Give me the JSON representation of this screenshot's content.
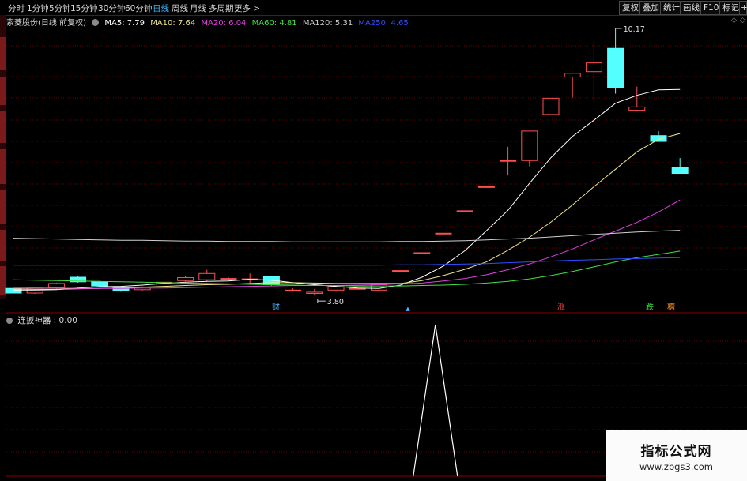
{
  "periods": [
    {
      "label": "分时",
      "active": false
    },
    {
      "label": "1分钟",
      "active": false
    },
    {
      "label": "5分钟",
      "active": false
    },
    {
      "label": "15分钟",
      "active": false
    },
    {
      "label": "30分钟",
      "active": false
    },
    {
      "label": "60分钟",
      "active": false
    },
    {
      "label": "日线",
      "active": true
    },
    {
      "label": "周线",
      "active": false
    },
    {
      "label": "月线",
      "active": false
    },
    {
      "label": "多周期",
      "active": false
    },
    {
      "label": "更多 >",
      "active": false
    }
  ],
  "toolbar_buttons": [
    "复权",
    "叠加",
    "统计",
    "画线",
    "F10",
    "标记",
    "+"
  ],
  "chart_title": "索菱股份(日线 前复权)",
  "ma_legend": [
    {
      "label": "MA5: 7.79",
      "color": "#ffffff"
    },
    {
      "label": "MA10: 7.64",
      "color": "#f0e68c"
    },
    {
      "label": "MA20: 6.04",
      "color": "#e040e0"
    },
    {
      "label": "MA60: 4.81",
      "color": "#40e040"
    },
    {
      "label": "MA120: 5.31",
      "color": "#cfcfcf"
    },
    {
      "label": "MA250: 4.65",
      "color": "#3050ff"
    }
  ],
  "price_high_label": "10.17",
  "price_low_label": "3.80",
  "event_markers": [
    {
      "text": "财",
      "color": "#4db8ff"
    },
    {
      "text": "▲",
      "color": "#4db8ff"
    },
    {
      "text": "涨",
      "color": "#ff4040"
    },
    {
      "text": "跌",
      "color": "#40e040"
    },
    {
      "text": "糟",
      "color": "#ff9020"
    }
  ],
  "indicator_title": "连扳神器 : 0.00",
  "watermark": {
    "title": "指标公式网",
    "url": "www.zbgs3.com"
  },
  "colors": {
    "up": "#ff5050",
    "down": "#54ffff",
    "grid": "#6a0000",
    "indicator_line": "#ffffff"
  },
  "chart_data": {
    "type": "candlestick",
    "candles": [
      {
        "o": 3.91,
        "c": 3.8,
        "h": 3.91,
        "l": 3.8
      },
      {
        "o": 3.8,
        "c": 3.92,
        "h": 3.95,
        "l": 3.78
      },
      {
        "o": 3.93,
        "c": 4.03,
        "h": 4.05,
        "l": 3.9
      },
      {
        "o": 4.18,
        "c": 4.07,
        "h": 4.2,
        "l": 4.05
      },
      {
        "o": 4.07,
        "c": 3.97,
        "h": 4.09,
        "l": 3.95
      },
      {
        "o": 3.93,
        "c": 3.85,
        "h": 3.95,
        "l": 3.83
      },
      {
        "o": 3.88,
        "c": 3.94,
        "h": 3.96,
        "l": 3.86
      },
      {
        "o": 4.05,
        "c": 4.06,
        "h": 4.08,
        "l": 4.03
      },
      {
        "o": 4.1,
        "c": 4.17,
        "h": 4.22,
        "l": 4.08
      },
      {
        "o": 4.12,
        "c": 4.27,
        "h": 4.36,
        "l": 4.08
      },
      {
        "o": 4.14,
        "c": 4.15,
        "h": 4.18,
        "l": 4.1
      },
      {
        "o": 4.13,
        "c": 4.14,
        "h": 4.27,
        "l": 4.04
      },
      {
        "o": 4.2,
        "c": 4.0,
        "h": 4.22,
        "l": 3.98
      },
      {
        "o": 3.86,
        "c": 3.87,
        "h": 3.91,
        "l": 3.84
      },
      {
        "o": 3.79,
        "c": 3.82,
        "h": 3.9,
        "l": 3.74
      },
      {
        "o": 3.87,
        "c": 3.95,
        "h": 3.98,
        "l": 3.86
      },
      {
        "o": 3.9,
        "c": 3.91,
        "h": 3.93,
        "l": 3.89
      },
      {
        "o": 3.87,
        "c": 4.0,
        "h": 4.02,
        "l": 3.85
      },
      {
        "o": 4.34,
        "c": 4.34,
        "h": 4.34,
        "l": 4.34
      },
      {
        "o": 4.77,
        "c": 4.77,
        "h": 4.77,
        "l": 4.77
      },
      {
        "o": 5.24,
        "c": 5.24,
        "h": 5.24,
        "l": 5.24
      },
      {
        "o": 5.78,
        "c": 5.78,
        "h": 5.78,
        "l": 5.78
      },
      {
        "o": 6.36,
        "c": 6.36,
        "h": 6.36,
        "l": 6.36
      },
      {
        "o": 6.99,
        "c": 6.99,
        "h": 7.32,
        "l": 6.63
      },
      {
        "o": 6.99,
        "c": 7.7,
        "h": 7.7,
        "l": 6.85
      },
      {
        "o": 8.1,
        "c": 8.49,
        "h": 8.49,
        "l": 8.1
      },
      {
        "o": 9.0,
        "c": 9.09,
        "h": 9.09,
        "l": 8.5
      },
      {
        "o": 9.13,
        "c": 9.34,
        "h": 9.85,
        "l": 8.4
      },
      {
        "o": 9.69,
        "c": 8.75,
        "h": 10.17,
        "l": 8.6
      },
      {
        "o": 8.2,
        "c": 8.28,
        "h": 8.77,
        "l": 8.2
      },
      {
        "o": 7.59,
        "c": 7.45,
        "h": 7.7,
        "l": 7.44
      },
      {
        "o": 6.83,
        "c": 6.68,
        "h": 7.05,
        "l": 6.68
      }
    ],
    "ma5": [
      3.87,
      3.87,
      3.88,
      3.92,
      3.95,
      3.96,
      3.99,
      4.03,
      4.06,
      4.08,
      4.09,
      4.13,
      4.11,
      4.05,
      4.0,
      3.96,
      3.92,
      3.91,
      3.99,
      4.18,
      4.45,
      4.82,
      5.3,
      5.79,
      6.44,
      7.06,
      7.57,
      7.96,
      8.37,
      8.56,
      8.69,
      8.7
    ],
    "ma10": [
      3.9,
      3.89,
      3.89,
      3.9,
      3.91,
      3.92,
      3.94,
      3.96,
      3.98,
      4.0,
      4.01,
      4.03,
      4.05,
      4.05,
      4.04,
      4.03,
      4.03,
      4.03,
      4.03,
      4.1,
      4.22,
      4.37,
      4.55,
      4.83,
      5.14,
      5.51,
      5.92,
      6.36,
      6.78,
      7.2,
      7.5,
      7.64
    ],
    "ma20": [
      3.92,
      3.92,
      3.92,
      3.91,
      3.91,
      3.91,
      3.92,
      3.92,
      3.93,
      3.94,
      3.95,
      3.96,
      3.97,
      3.98,
      3.98,
      3.98,
      3.99,
      4.0,
      4.02,
      4.04,
      4.09,
      4.15,
      4.24,
      4.36,
      4.5,
      4.67,
      4.86,
      5.08,
      5.29,
      5.5,
      5.75,
      6.04
    ],
    "ma60": [
      4.12,
      4.11,
      4.1,
      4.09,
      4.08,
      4.07,
      4.06,
      4.05,
      4.04,
      4.03,
      4.02,
      4.01,
      4.0,
      3.99,
      3.98,
      3.98,
      3.97,
      3.97,
      3.97,
      3.98,
      3.99,
      4.01,
      4.04,
      4.08,
      4.14,
      4.22,
      4.32,
      4.43,
      4.55,
      4.65,
      4.73,
      4.81
    ],
    "ma120": [
      5.12,
      5.11,
      5.1,
      5.09,
      5.08,
      5.07,
      5.07,
      5.06,
      5.05,
      5.05,
      5.04,
      5.04,
      5.04,
      5.03,
      5.03,
      5.03,
      5.03,
      5.03,
      5.04,
      5.04,
      5.05,
      5.06,
      5.08,
      5.1,
      5.12,
      5.15,
      5.18,
      5.21,
      5.24,
      5.27,
      5.29,
      5.31
    ],
    "ma250": [
      4.47,
      4.47,
      4.47,
      4.47,
      4.47,
      4.47,
      4.47,
      4.47,
      4.47,
      4.47,
      4.47,
      4.47,
      4.47,
      4.47,
      4.47,
      4.47,
      4.47,
      4.47,
      4.48,
      4.48,
      4.49,
      4.5,
      4.51,
      4.53,
      4.55,
      4.57,
      4.59,
      4.6,
      4.62,
      4.63,
      4.64,
      4.65
    ],
    "indicator": {
      "name": "连扳神器",
      "values": [
        0,
        0,
        0,
        0,
        0,
        0,
        0,
        0,
        0,
        0,
        0,
        0,
        0,
        0,
        0,
        0,
        0,
        0,
        0,
        1,
        0,
        0,
        0,
        0,
        0,
        0,
        0,
        0,
        0,
        0,
        0,
        0
      ]
    },
    "grid": true
  }
}
